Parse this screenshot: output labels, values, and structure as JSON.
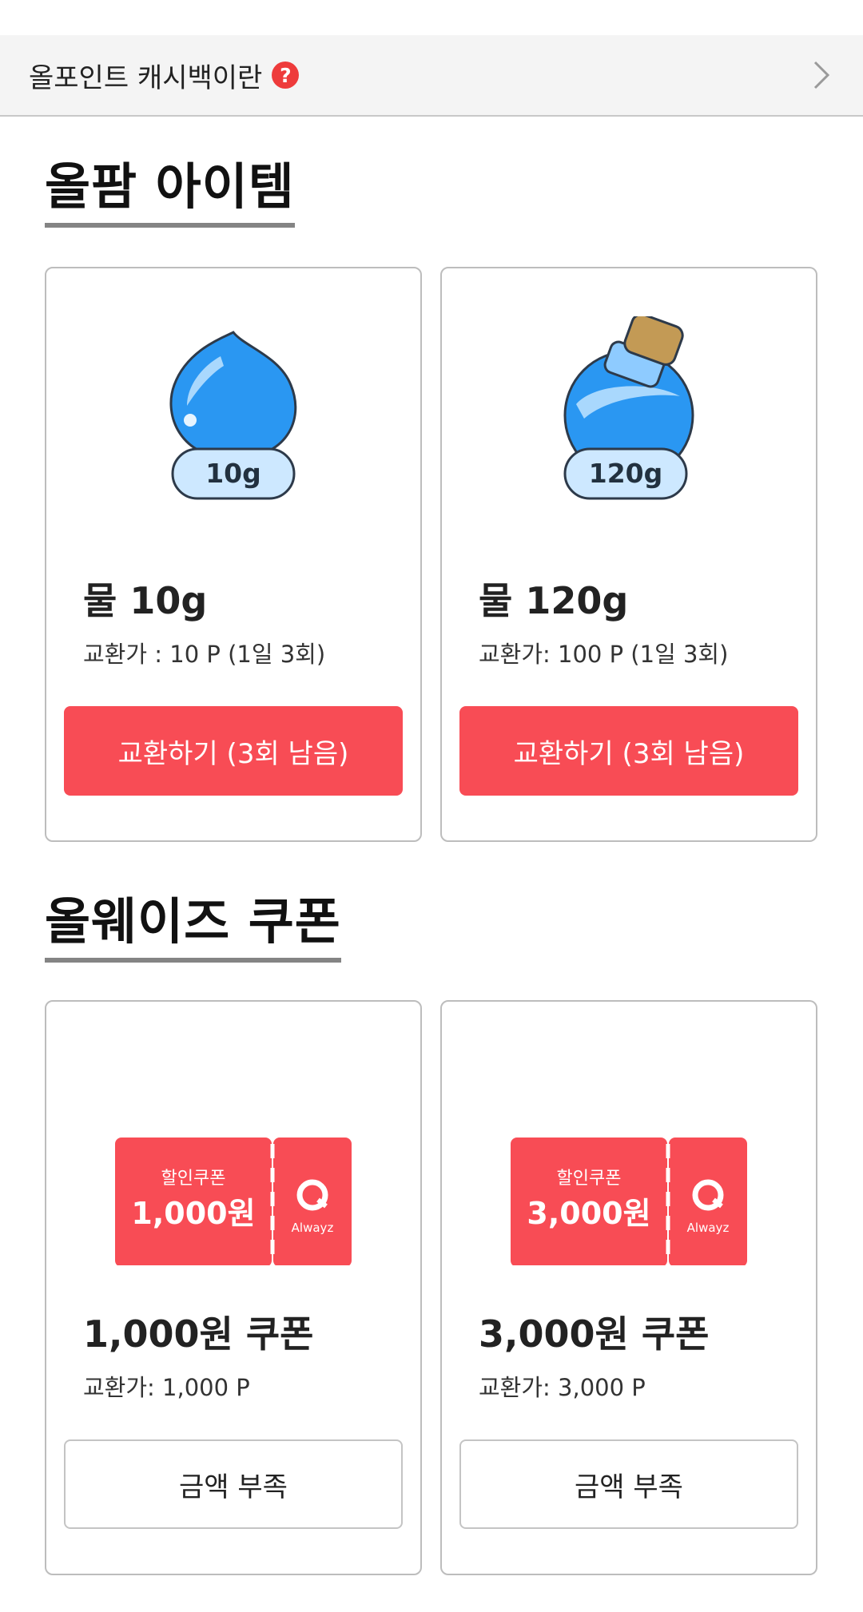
{
  "info_bar": {
    "label": "올포인트 캐시백이란",
    "help_icon": "question-circle-icon",
    "chevron_icon": "chevron-right-icon"
  },
  "sections": {
    "items_title": "올팜 아이템",
    "coupons_title": "올웨이즈 쿠폰"
  },
  "items": [
    {
      "icon": "water-drop-icon",
      "badge": "10g",
      "name": "물 10g",
      "price": "교환가 : 10 P (1일 3회)",
      "button": "교환하기 (3회 남음)"
    },
    {
      "icon": "water-bottle-icon",
      "badge": "120g",
      "name": "물 120g",
      "price": "교환가: 100 P (1일 3회)",
      "button": "교환하기 (3회 남음)"
    }
  ],
  "coupons": [
    {
      "icon": "coupon-ticket-icon",
      "ticket_caption": "할인쿠폰",
      "ticket_amount": "1,000원",
      "brand": "Alwayz",
      "name": "1,000원 쿠폰",
      "price": "교환가: 1,000 P",
      "button": "금액 부족"
    },
    {
      "icon": "coupon-ticket-icon",
      "ticket_caption": "할인쿠폰",
      "ticket_amount": "3,000원",
      "brand": "Alwayz",
      "name": "3,000원 쿠폰",
      "price": "교환가: 3,000 P",
      "button": "금액 부족"
    }
  ],
  "colors": {
    "accent": "#f84c55",
    "water": "#2a97f2",
    "underline": "#848484"
  }
}
